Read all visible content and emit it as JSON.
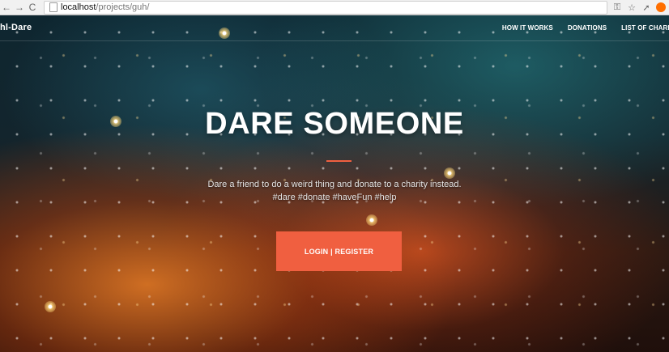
{
  "browser": {
    "url_host": "localhost",
    "url_path": "/projects/guh/",
    "icons": {
      "back": "back-icon",
      "forward": "forward-icon",
      "reload": "reload-icon",
      "page": "page-icon",
      "key": "key-icon",
      "star": "star-icon",
      "extension": "extension-icon",
      "profile": "profile-icon"
    }
  },
  "nav": {
    "brand": "hl-Dare",
    "links": [
      "HOW IT WORKS",
      "DONATIONS",
      "LIST OF CHARITI"
    ]
  },
  "hero": {
    "title": "DARE SOMEONE",
    "tagline_line1": "Dare a friend to do a weird thing and donate to a charity instead.",
    "tagline_line2": "#dare #donate #haveFun #help",
    "cta": "LOGIN | REGISTER"
  },
  "colors": {
    "accent": "#f05f40"
  }
}
